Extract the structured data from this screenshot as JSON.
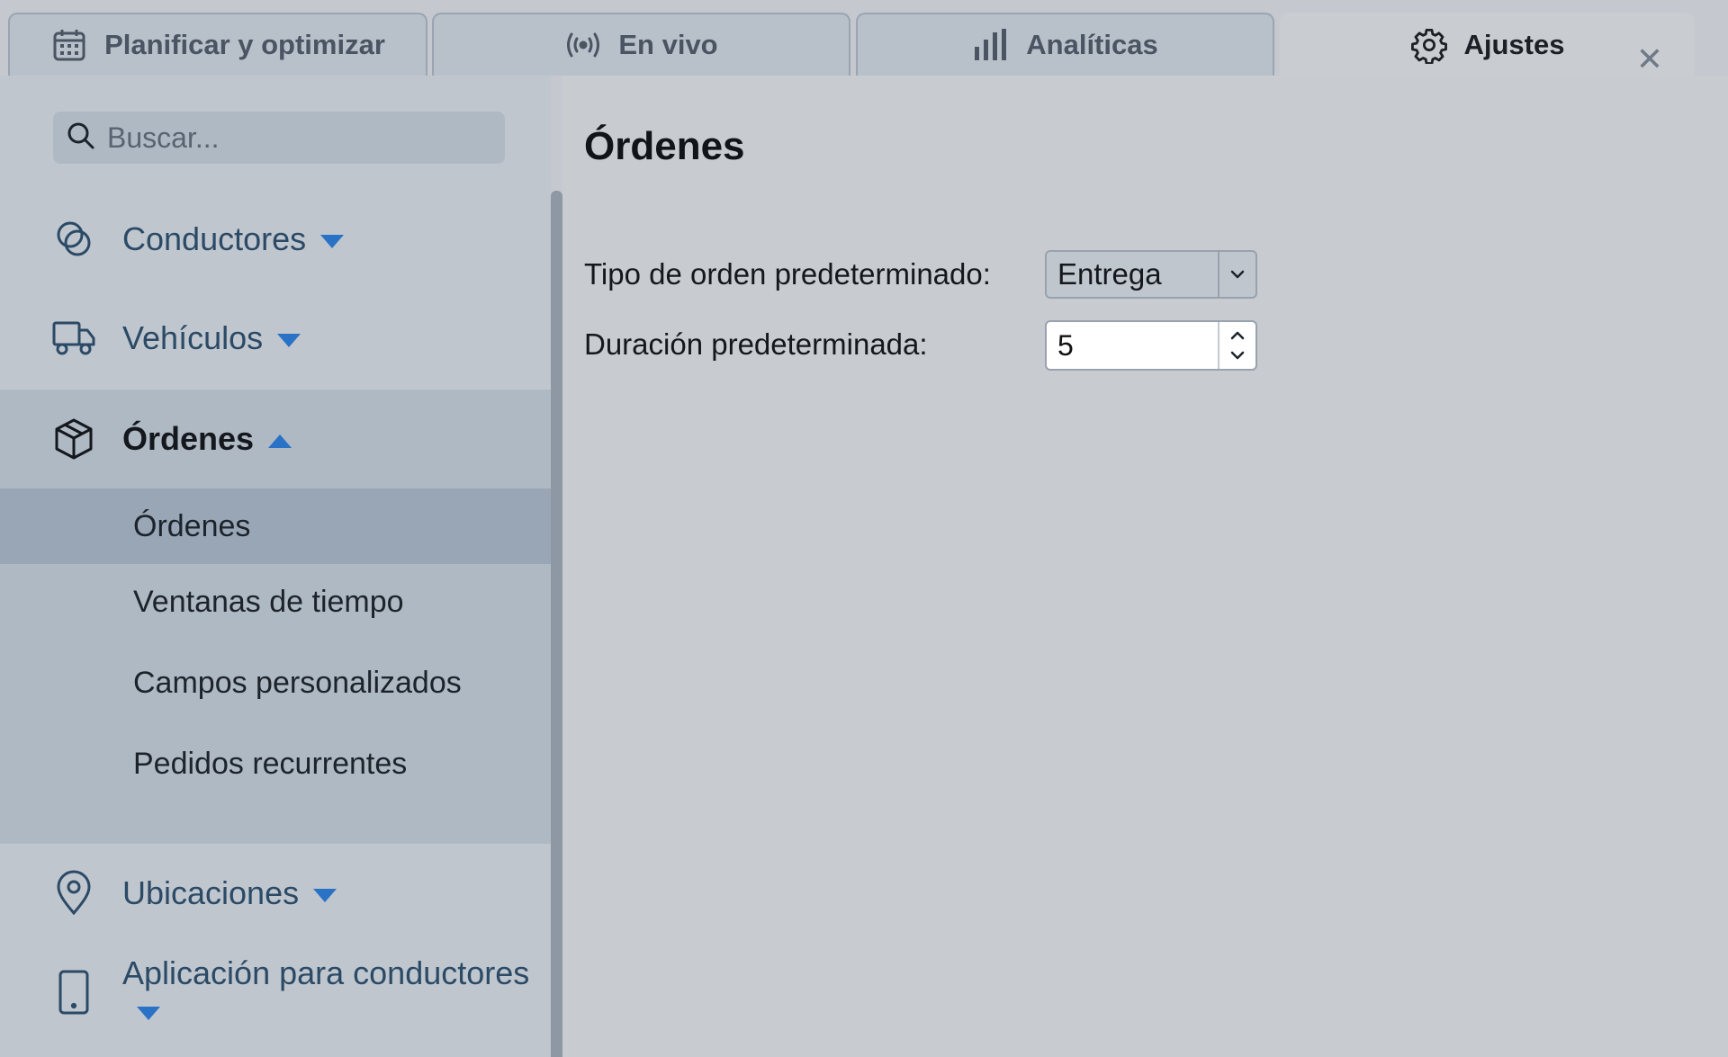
{
  "tabs": [
    {
      "label": "Planificar y optimizar",
      "icon": "calendar-icon",
      "active": false
    },
    {
      "label": "En vivo",
      "icon": "broadcast-icon",
      "active": false
    },
    {
      "label": "Analíticas",
      "icon": "bar-chart-icon",
      "active": false
    },
    {
      "label": "Ajustes",
      "icon": "gear-icon",
      "active": true
    }
  ],
  "search": {
    "placeholder": "Buscar..."
  },
  "sidebar": {
    "items": [
      {
        "label": "Conductores",
        "icon": "drivers-icon",
        "expanded": false
      },
      {
        "label": "Vehículos",
        "icon": "truck-icon",
        "expanded": false
      },
      {
        "label": "Órdenes",
        "icon": "package-icon",
        "expanded": true
      },
      {
        "label": "Ubicaciones",
        "icon": "map-pin-icon",
        "expanded": false
      },
      {
        "label": "Aplicación para conductores",
        "icon": "phone-icon",
        "expanded": false
      }
    ],
    "orders_sub": [
      {
        "label": "Órdenes",
        "active": true
      },
      {
        "label": "Ventanas de tiempo",
        "active": false
      },
      {
        "label": "Campos personalizados",
        "active": false
      },
      {
        "label": "Pedidos recurrentes",
        "active": false
      }
    ]
  },
  "main": {
    "title": "Órdenes",
    "fields": {
      "order_type": {
        "label": "Tipo de orden predeterminado:",
        "value": "Entrega"
      },
      "duration": {
        "label": "Duración predeterminada:",
        "value": "5"
      }
    }
  },
  "colors": {
    "accent": "#2a72c6",
    "active_sub_bg": "#98a6b6",
    "sidebar_bg": "#c0c6ce"
  }
}
